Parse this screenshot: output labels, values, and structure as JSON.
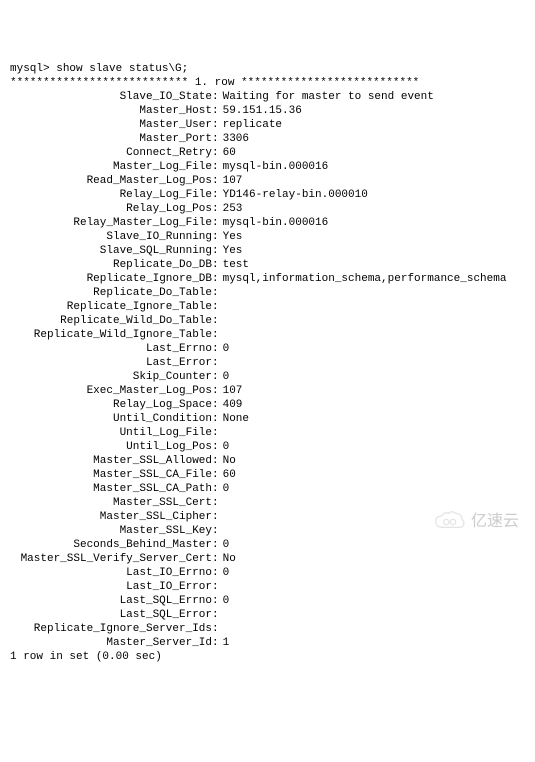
{
  "prompt": "mysql>",
  "command": "show slave status\\G;",
  "row_header": "*************************** 1. row ***************************",
  "fields": [
    {
      "label": "Slave_IO_State",
      "value": "Waiting for master to send event"
    },
    {
      "label": "Master_Host",
      "value": "59.151.15.36"
    },
    {
      "label": "Master_User",
      "value": "replicate"
    },
    {
      "label": "Master_Port",
      "value": "3306"
    },
    {
      "label": "Connect_Retry",
      "value": "60"
    },
    {
      "label": "Master_Log_File",
      "value": "mysql-bin.000016"
    },
    {
      "label": "Read_Master_Log_Pos",
      "value": "107"
    },
    {
      "label": "Relay_Log_File",
      "value": "YD146-relay-bin.000010"
    },
    {
      "label": "Relay_Log_Pos",
      "value": "253"
    },
    {
      "label": "Relay_Master_Log_File",
      "value": "mysql-bin.000016"
    },
    {
      "label": "Slave_IO_Running",
      "value": "Yes"
    },
    {
      "label": "Slave_SQL_Running",
      "value": "Yes"
    },
    {
      "label": "Replicate_Do_DB",
      "value": "test"
    },
    {
      "label": "Replicate_Ignore_DB",
      "value": "mysql,information_schema,performance_schema"
    },
    {
      "label": "Replicate_Do_Table",
      "value": ""
    },
    {
      "label": "Replicate_Ignore_Table",
      "value": ""
    },
    {
      "label": "Replicate_Wild_Do_Table",
      "value": ""
    },
    {
      "label": "Replicate_Wild_Ignore_Table",
      "value": ""
    },
    {
      "label": "Last_Errno",
      "value": "0"
    },
    {
      "label": "Last_Error",
      "value": ""
    },
    {
      "label": "Skip_Counter",
      "value": "0"
    },
    {
      "label": "Exec_Master_Log_Pos",
      "value": "107"
    },
    {
      "label": "Relay_Log_Space",
      "value": "409"
    },
    {
      "label": "Until_Condition",
      "value": "None"
    },
    {
      "label": "Until_Log_File",
      "value": ""
    },
    {
      "label": "Until_Log_Pos",
      "value": "0"
    },
    {
      "label": "Master_SSL_Allowed",
      "value": "No"
    },
    {
      "label": "Master_SSL_CA_File",
      "value": "60"
    },
    {
      "label": "Master_SSL_CA_Path",
      "value": "0"
    },
    {
      "label": "Master_SSL_Cert",
      "value": ""
    },
    {
      "label": "Master_SSL_Cipher",
      "value": ""
    },
    {
      "label": "Master_SSL_Key",
      "value": ""
    },
    {
      "label": "Seconds_Behind_Master",
      "value": "0"
    },
    {
      "label": "Master_SSL_Verify_Server_Cert",
      "value": "No"
    },
    {
      "label": "Last_IO_Errno",
      "value": "0"
    },
    {
      "label": "Last_IO_Error",
      "value": ""
    },
    {
      "label": "Last_SQL_Errno",
      "value": "0"
    },
    {
      "label": "Last_SQL_Error",
      "value": ""
    },
    {
      "label": "Replicate_Ignore_Server_Ids",
      "value": ""
    },
    {
      "label": "Master_Server_Id",
      "value": "1"
    }
  ],
  "footer": "1 row in set (0.00 sec)",
  "watermark": "亿速云"
}
